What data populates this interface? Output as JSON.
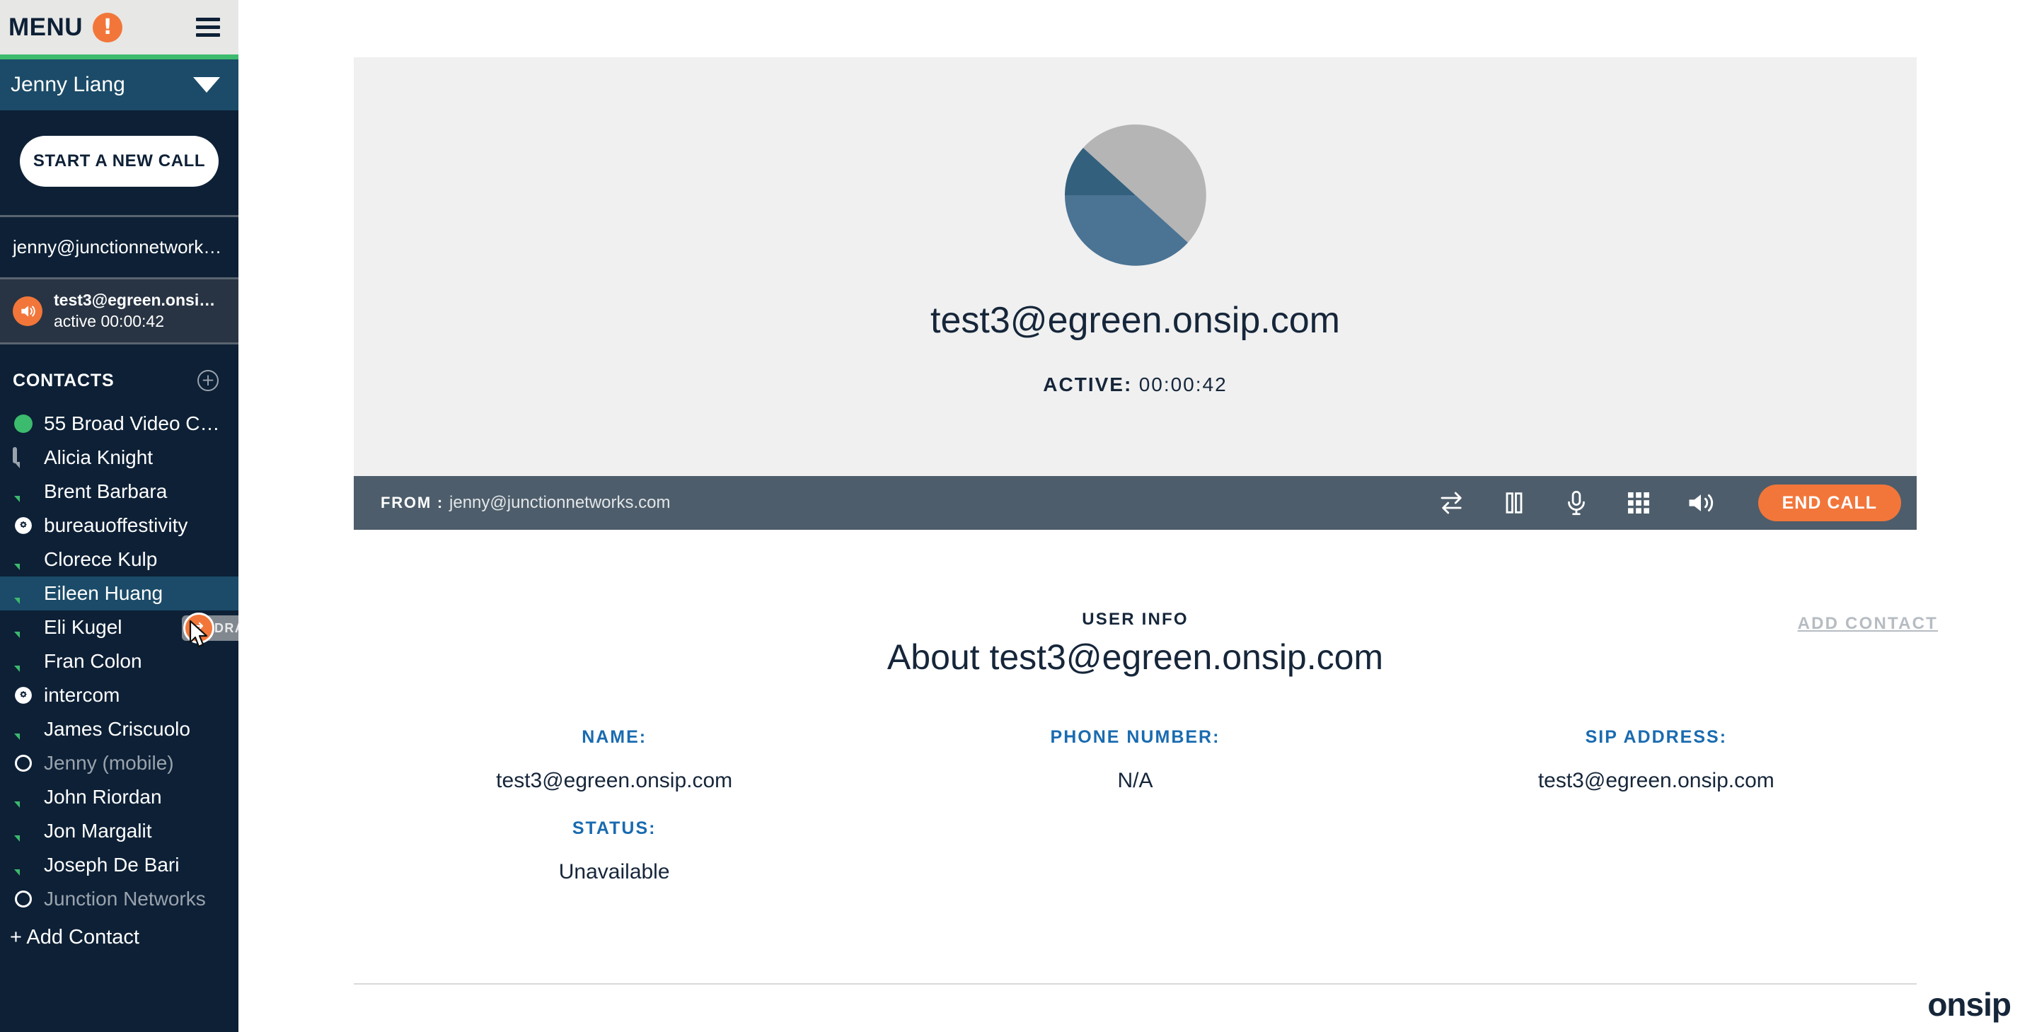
{
  "sidebar": {
    "menu": {
      "label": "MENU",
      "alert_icon": "alert-exclamation-icon",
      "hamburger_icon": "hamburger-menu-icon"
    },
    "account": {
      "name": "Jenny Liang",
      "caret_icon": "chevron-down-icon"
    },
    "new_call_button": "START A NEW CALL",
    "identity": "jenny@junctionnetwork…",
    "active_call": {
      "name": "test3@egreen.onsi…",
      "status": "active 00:00:42",
      "icon": "speaker-active-icon"
    },
    "contacts_header": {
      "title": "CONTACTS",
      "add_icon": "plus-circle-icon"
    },
    "contacts": [
      {
        "label": "55 Broad Video C…",
        "presence": "dot-green",
        "offline": false
      },
      {
        "label": "Alicia Knight",
        "presence": "bubble-gray",
        "offline": false
      },
      {
        "label": "Brent Barbara",
        "presence": "bubble-green",
        "offline": false
      },
      {
        "label": "bureauoffestivity",
        "presence": "gear",
        "offline": false
      },
      {
        "label": "Clorece Kulp",
        "presence": "bubble-green",
        "offline": false
      },
      {
        "label": "Eileen Huang",
        "presence": "bubble-green",
        "offline": false,
        "selected": true
      },
      {
        "label": "Eli Kugel",
        "presence": "bubble-green",
        "offline": false
      },
      {
        "label": "Fran Colon",
        "presence": "bubble-green",
        "offline": false
      },
      {
        "label": "intercom",
        "presence": "gear",
        "offline": false
      },
      {
        "label": "James Criscuolo",
        "presence": "bubble-green",
        "offline": false
      },
      {
        "label": "Jenny (mobile)",
        "presence": "ring",
        "offline": true
      },
      {
        "label": "John Riordan",
        "presence": "bubble-green",
        "offline": false
      },
      {
        "label": "Jon Margalit",
        "presence": "bubble-green",
        "offline": false
      },
      {
        "label": "Joseph De Bari",
        "presence": "bubble-green",
        "offline": false
      },
      {
        "label": "Junction Networks",
        "presence": "ring",
        "offline": true
      }
    ],
    "add_contact": "+ Add Contact",
    "drag_tooltip": "DRAG CALL TO TRANSFER"
  },
  "call": {
    "avatar_icon": "pie-avatar-icon",
    "target": "test3@egreen.onsip.com",
    "status_label": "ACTIVE:",
    "timer": "00:00:42",
    "from_label": "FROM :",
    "from_value": "jenny@junctionnetworks.com",
    "controls": [
      {
        "name": "transfer-icon",
        "title": "Transfer"
      },
      {
        "name": "hold-icon",
        "title": "Hold"
      },
      {
        "name": "mute-microphone-icon",
        "title": "Mute"
      },
      {
        "name": "keypad-icon",
        "title": "Keypad"
      },
      {
        "name": "speaker-volume-icon",
        "title": "Volume"
      }
    ],
    "end_call_button": "END CALL"
  },
  "user_info": {
    "kicker": "USER INFO",
    "title": "About test3@egreen.onsip.com",
    "add_contact_link": "ADD CONTACT",
    "fields": [
      {
        "label": "NAME:",
        "value": "test3@egreen.onsip.com"
      },
      {
        "label": "PHONE NUMBER:",
        "value": "N/A"
      },
      {
        "label": "SIP ADDRESS:",
        "value": "test3@egreen.onsip.com"
      },
      {
        "label": "STATUS:",
        "value": "Unavailable"
      }
    ]
  },
  "footer": {
    "logo": "onsip"
  },
  "colors": {
    "sidebar_bg": "#0d2036",
    "accent_orange": "#f2763a",
    "accent_green": "#3cba6d",
    "account_blue": "#1b4b68",
    "label_blue": "#1a6bb0",
    "control_bar": "#4d5d6b",
    "panel_bg": "#f0f0f0"
  }
}
